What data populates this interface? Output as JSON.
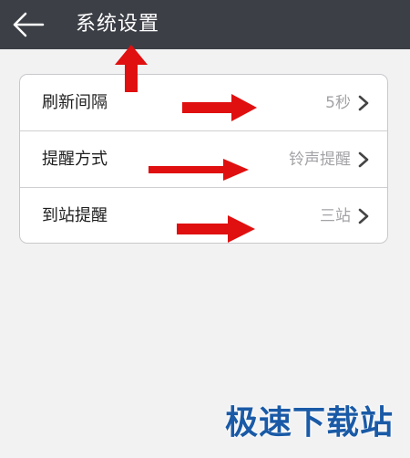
{
  "header": {
    "title": "系统设置",
    "back_icon": "arrow-left-icon",
    "background": "#3c3f46"
  },
  "settings": {
    "items": [
      {
        "label": "刷新间隔",
        "value": "5秒",
        "icon": "chevron-right-icon"
      },
      {
        "label": "提醒方式",
        "value": "铃声提醒",
        "icon": "chevron-right-icon"
      },
      {
        "label": "到站提醒",
        "value": "三站",
        "icon": "chevron-right-icon"
      }
    ]
  },
  "annotations": {
    "color": "#e01010",
    "icons": [
      "arrow-up-icon",
      "arrow-right-icon",
      "arrow-right-icon",
      "arrow-right-icon"
    ]
  },
  "watermark": {
    "text": "极速下载站",
    "color": "#1a5aa6"
  }
}
